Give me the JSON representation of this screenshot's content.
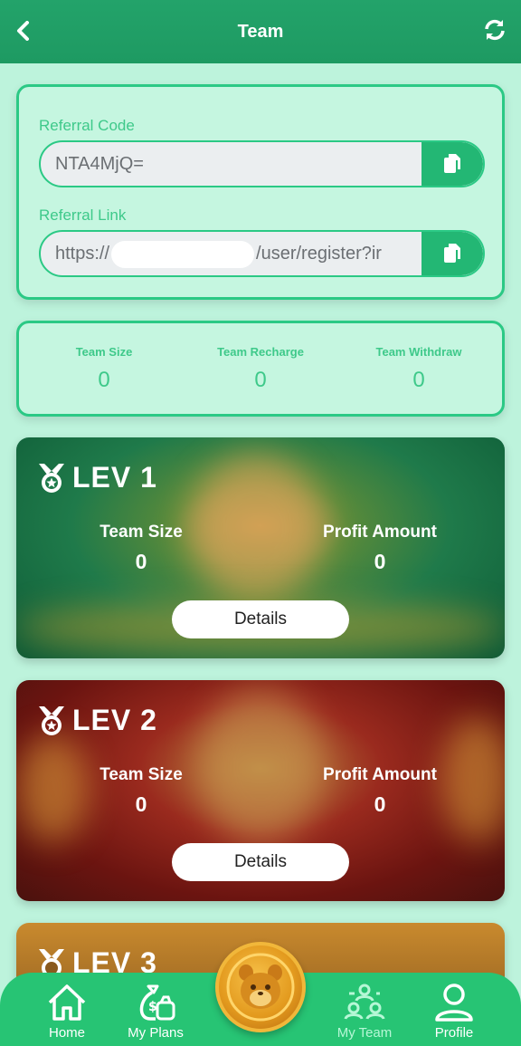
{
  "header": {
    "title": "Team"
  },
  "referral": {
    "code_label": "Referral Code",
    "code_value": "NTA4MjQ=",
    "link_label": "Referral Link",
    "link_prefix": "https://",
    "link_suffix": "/user/register?ir"
  },
  "stats": [
    {
      "label": "Team Size",
      "value": "0"
    },
    {
      "label": "Team Recharge",
      "value": "0"
    },
    {
      "label": "Team Withdraw",
      "value": "0"
    }
  ],
  "levels": [
    {
      "name": "LEV 1",
      "size_label": "Team Size",
      "size_value": "0",
      "profit_label": "Profit Amount",
      "profit_value": "0",
      "button": "Details"
    },
    {
      "name": "LEV 2",
      "size_label": "Team Size",
      "size_value": "0",
      "profit_label": "Profit Amount",
      "profit_value": "0",
      "button": "Details"
    },
    {
      "name": "LEV 3"
    }
  ],
  "nav": [
    {
      "label": "Home",
      "icon": "home-icon"
    },
    {
      "label": "My Plans",
      "icon": "money-bag-icon"
    },
    {
      "label": "My Team",
      "icon": "team-icon",
      "active": true
    },
    {
      "label": "Profile",
      "icon": "user-icon"
    }
  ],
  "colors": {
    "primary": "#23a36a",
    "accent": "#2bc985",
    "background": "#bdf3dc"
  }
}
